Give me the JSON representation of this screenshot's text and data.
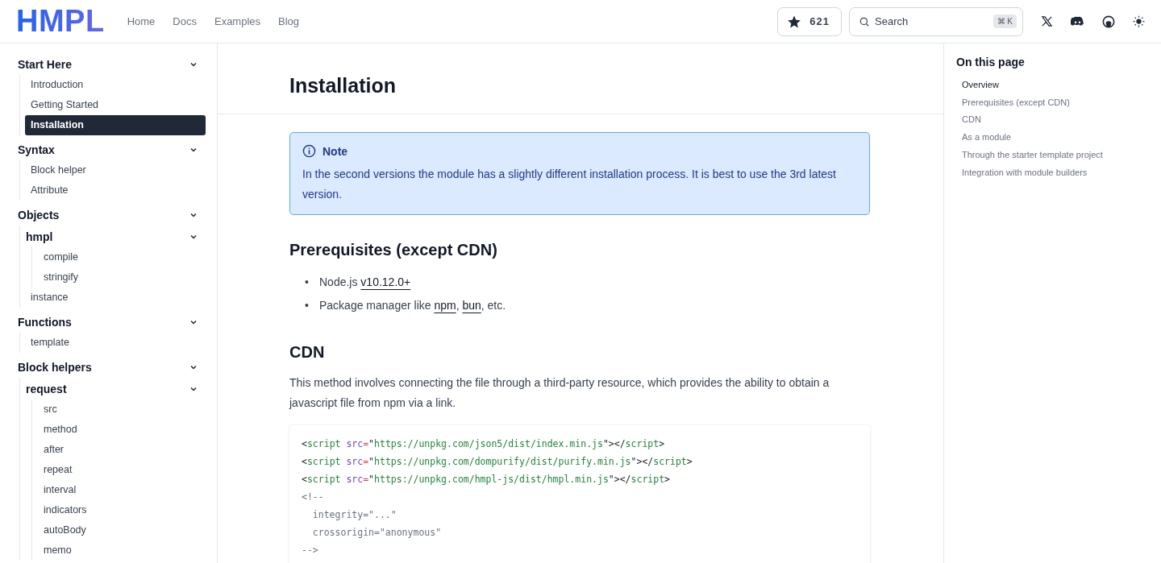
{
  "header": {
    "logo": "HMPL",
    "nav": [
      "Home",
      "Docs",
      "Examples",
      "Blog"
    ],
    "stars": "621",
    "search": {
      "placeholder": "Search",
      "shortcut": "⌘ K"
    }
  },
  "sidebar": {
    "sections": [
      {
        "label": "Start Here",
        "expanded": true,
        "children": [
          {
            "label": "Introduction",
            "selected": false
          },
          {
            "label": "Getting Started",
            "selected": false
          },
          {
            "label": "Installation",
            "selected": true
          }
        ]
      },
      {
        "label": "Syntax",
        "expanded": true,
        "children": [
          {
            "label": "Block helper",
            "selected": false
          },
          {
            "label": "Attribute",
            "selected": false
          }
        ]
      },
      {
        "label": "Objects",
        "expanded": true,
        "children": [
          {
            "label": "hmpl",
            "expanded": true,
            "children": [
              {
                "label": "compile",
                "selected": false
              },
              {
                "label": "stringify",
                "selected": false
              }
            ]
          },
          {
            "label": "instance",
            "selected": false
          }
        ]
      },
      {
        "label": "Functions",
        "expanded": true,
        "children": [
          {
            "label": "template",
            "selected": false
          }
        ]
      },
      {
        "label": "Block helpers",
        "expanded": true,
        "children": [
          {
            "label": "request",
            "expanded": true,
            "children": [
              {
                "label": "src",
                "selected": false
              },
              {
                "label": "method",
                "selected": false
              },
              {
                "label": "after",
                "selected": false
              },
              {
                "label": "repeat",
                "selected": false
              },
              {
                "label": "interval",
                "selected": false
              },
              {
                "label": "indicators",
                "selected": false
              },
              {
                "label": "autoBody",
                "selected": false
              },
              {
                "label": "memo",
                "selected": false
              }
            ]
          }
        ]
      }
    ]
  },
  "content": {
    "title": "Installation",
    "note": {
      "title": "Note",
      "text": "In the second versions the module has a slightly different installation process. It is best to use the 3rd latest version."
    },
    "sections": [
      {
        "heading": "Prerequisites (except CDN)",
        "bullets": [
          {
            "marker": "•",
            "parts": [
              {
                "text": "Node.js ",
                "link": false
              },
              {
                "text": "v10.12.0+",
                "link": true
              }
            ]
          },
          {
            "marker": "•",
            "parts": [
              {
                "text": "Package manager like ",
                "link": false
              },
              {
                "text": "npm",
                "link": true
              },
              {
                "text": ", ",
                "link": false
              },
              {
                "text": "bun",
                "link": true
              },
              {
                "text": ", etc.",
                "link": false
              }
            ]
          }
        ]
      },
      {
        "heading": "CDN",
        "paragraph": "This method involves connecting the file through a third-party resource, which provides the ability to obtain a javascript file from npm via a link.",
        "code": [
          [
            {
              "kind": "punct",
              "text": "<"
            },
            {
              "kind": "tag",
              "text": "script"
            },
            {
              "kind": "attr",
              "text": "src"
            },
            {
              "kind": "eq",
              "text": "="
            },
            {
              "kind": "punct",
              "text": "\""
            },
            {
              "kind": "str",
              "text": "https://unpkg.com/json5/dist/index.min.js"
            },
            {
              "kind": "punct",
              "text": "\"></"
            },
            {
              "kind": "tag",
              "text": "script"
            },
            {
              "kind": "punct",
              "text": ">"
            }
          ],
          [
            {
              "kind": "punct",
              "text": "<"
            },
            {
              "kind": "tag",
              "text": "script"
            },
            {
              "kind": "attr",
              "text": "src"
            },
            {
              "kind": "eq",
              "text": "="
            },
            {
              "kind": "punct",
              "text": "\""
            },
            {
              "kind": "str",
              "text": "https://unpkg.com/dompurify/dist/purify.min.js"
            },
            {
              "kind": "punct",
              "text": "\"></"
            },
            {
              "kind": "tag",
              "text": "script"
            },
            {
              "kind": "punct",
              "text": ">"
            }
          ],
          [
            {
              "kind": "punct",
              "text": "<"
            },
            {
              "kind": "tag",
              "text": "script"
            },
            {
              "kind": "attr",
              "text": "src"
            },
            {
              "kind": "eq",
              "text": "="
            },
            {
              "kind": "punct",
              "text": "\""
            },
            {
              "kind": "str",
              "text": "https://unpkg.com/hmpl-js/dist/hmpl.min.js"
            },
            {
              "kind": "punct",
              "text": "\"></"
            },
            {
              "kind": "tag",
              "text": "script"
            },
            {
              "kind": "punct",
              "text": ">"
            }
          ],
          [
            {
              "kind": "comment",
              "text": "<!--"
            }
          ],
          [
            {
              "kind": "comment",
              "text": "  integrity=\"...\""
            }
          ],
          [
            {
              "kind": "comment",
              "text": "  crossorigin=\"anonymous\""
            }
          ],
          [
            {
              "kind": "comment",
              "text": "-->"
            }
          ]
        ]
      }
    ]
  },
  "toc": {
    "title": "On this page",
    "items": [
      {
        "label": "Overview",
        "selected": true
      },
      {
        "label": "Prerequisites (except CDN)",
        "selected": false
      },
      {
        "label": "CDN",
        "selected": false
      },
      {
        "label": "As a module",
        "selected": false
      },
      {
        "label": "Through the starter template project",
        "selected": false
      },
      {
        "label": "Integration with module builders",
        "selected": false
      }
    ]
  }
}
